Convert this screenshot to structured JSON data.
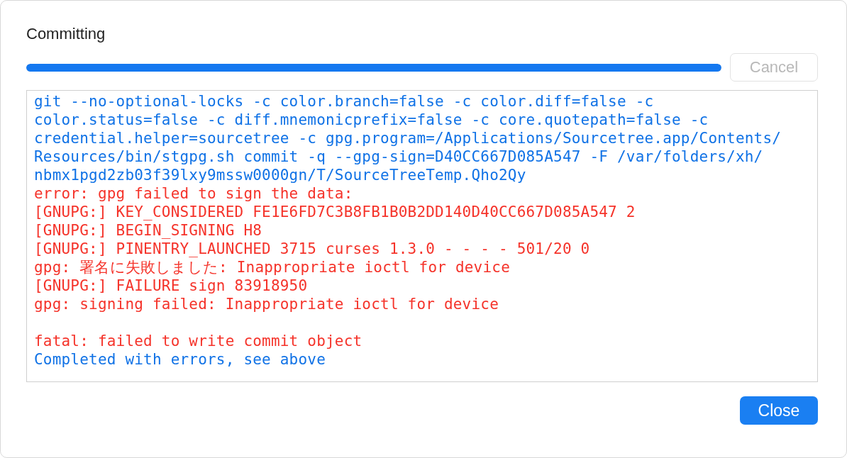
{
  "dialog": {
    "title": "Committing"
  },
  "progress": {
    "level": 1.0
  },
  "cancel_button": {
    "label": "Cancel",
    "disabled": true
  },
  "log": [
    {
      "kind": "command",
      "text": "git --no-optional-locks -c color.branch=false -c color.diff=false -c"
    },
    {
      "kind": "command",
      "text": "color.status=false -c diff.mnemonicprefix=false -c core.quotepath=false -c"
    },
    {
      "kind": "command",
      "text": "credential.helper=sourcetree -c gpg.program=/Applications/Sourcetree.app/Contents/"
    },
    {
      "kind": "command",
      "text": "Resources/bin/stgpg.sh commit -q --gpg-sign=D40CC667D085A547 -F /var/folders/xh/"
    },
    {
      "kind": "command",
      "text": "nbmx1pgd2zb03f39lxy9mssw0000gn/T/SourceTreeTemp.Qho2Qy"
    },
    {
      "kind": "error",
      "text": "error: gpg failed to sign the data:"
    },
    {
      "kind": "error",
      "text": "[GNUPG:] KEY_CONSIDERED FE1E6FD7C3B8FB1B0B2DD140D40CC667D085A547 2"
    },
    {
      "kind": "error",
      "text": "[GNUPG:] BEGIN_SIGNING H8"
    },
    {
      "kind": "error",
      "text": "[GNUPG:] PINENTRY_LAUNCHED 3715 curses 1.3.0 - - - - 501/20 0"
    },
    {
      "kind": "error",
      "text": "gpg: 署名に失敗しました: Inappropriate ioctl for device"
    },
    {
      "kind": "error",
      "text": "[GNUPG:] FAILURE sign 83918950"
    },
    {
      "kind": "error",
      "text": "gpg: signing failed: Inappropriate ioctl for device"
    },
    {
      "kind": "blank"
    },
    {
      "kind": "error",
      "text": "fatal: failed to write commit object"
    },
    {
      "kind": "command",
      "text": "Completed with errors, see above"
    }
  ],
  "close_button": {
    "label": "Close"
  }
}
